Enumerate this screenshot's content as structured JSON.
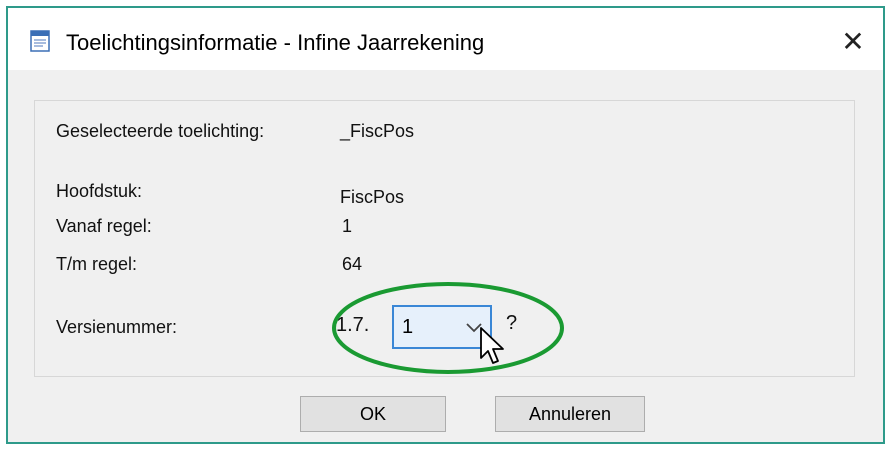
{
  "window": {
    "title": "Toelichtingsinformatie - Infine Jaarrekening",
    "close_label": "✕",
    "app_icon": "document-icon"
  },
  "fields": {
    "selected_label": "Geselecteerde toelichting:",
    "selected_value": "_FiscPos",
    "chapter_label": "Hoofdstuk:",
    "chapter_value": "FiscPos",
    "from_label": "Vanaf regel:",
    "from_value": "1",
    "to_label": "T/m regel:",
    "to_value": "64",
    "version_label": "Versienummer:",
    "version_prefix": "1.7.",
    "version_value": "1",
    "version_unknown": "?"
  },
  "buttons": {
    "ok": "OK",
    "cancel": "Annuleren"
  },
  "colors": {
    "highlight": "#1a9a32",
    "combo_border": "#3a87d6",
    "window_border": "#2e9a8a"
  }
}
